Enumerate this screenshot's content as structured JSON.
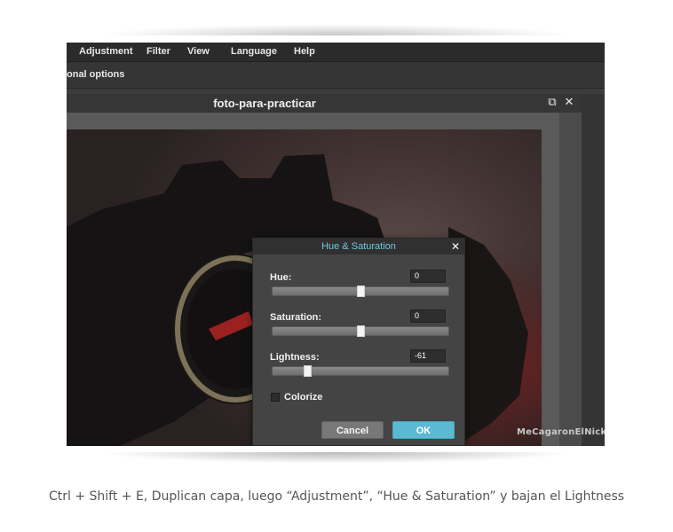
{
  "menu": {
    "items": [
      "Adjustment",
      "Filter",
      "View",
      "Language",
      "Help"
    ]
  },
  "toolbar": {
    "label": "onal options"
  },
  "document": {
    "title": "foto-para-practicar",
    "restore_glyph": "⧉",
    "close_glyph": "✕"
  },
  "watermark": "MeCagaronElNick",
  "dialog": {
    "title": "Hue & Saturation",
    "close_glyph": "✕",
    "hue": {
      "label": "Hue:",
      "value": "0",
      "fraction": 0.5
    },
    "saturation": {
      "label": "Saturation:",
      "value": "0",
      "fraction": 0.5
    },
    "lightness": {
      "label": "Lightness:",
      "value": "-61",
      "fraction": 0.195
    },
    "colorize_label": "Colorize",
    "colorize_checked": false,
    "cancel_label": "Cancel",
    "ok_label": "OK"
  },
  "colors": {
    "accent": "#5bb9d4",
    "dialog_title": "#6fc7e0"
  },
  "caption": "Ctrl + Shift + E, Duplican capa, luego “Adjustment”, “Hue & Saturation” y bajan el Lightness"
}
